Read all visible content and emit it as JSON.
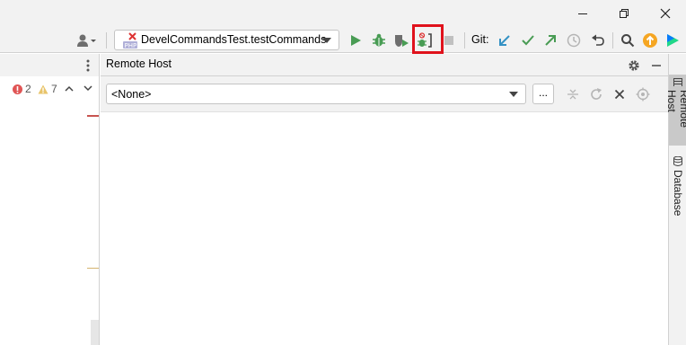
{
  "window": {
    "minimize_icon": "minimize-icon",
    "restore_icon": "restore-icon",
    "close_icon": "close-icon"
  },
  "toolbar": {
    "run_config": {
      "label": "DevelCommandsTest.testCommands",
      "icon": "php-test-icon"
    },
    "git_label": "Git:",
    "colors": {
      "run_green": "#499c54",
      "highlight_red": "#e0121c",
      "update_orange": "#f5a623",
      "git_blue": "#3592c4"
    }
  },
  "inspections": {
    "errors": "2",
    "warnings": "7"
  },
  "remote_host": {
    "title": "Remote Host",
    "host_value": "<None>",
    "browse_label": "..."
  },
  "right_tabs": [
    {
      "label": "Remote Host",
      "active": true
    },
    {
      "label": "Database",
      "active": false
    }
  ]
}
